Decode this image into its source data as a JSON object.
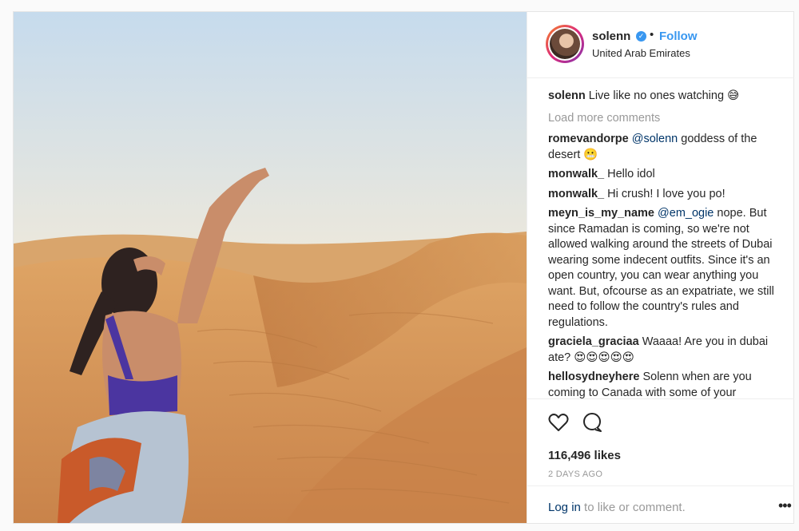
{
  "post": {
    "username": "solenn",
    "follow_label": "Follow",
    "dot": "•",
    "location": "United Arab Emirates",
    "caption_user": "solenn",
    "caption_text": "Live like no ones watching 😅",
    "load_more": "Load more comments",
    "comments": [
      {
        "user": "romevandorpe",
        "mention": "@solenn",
        "text": "goddess of the desert 😬"
      },
      {
        "user": "monwalk_",
        "mention": "",
        "text": "Hello idol"
      },
      {
        "user": "monwalk_",
        "mention": "",
        "text": "Hi crush! I love you po!"
      },
      {
        "user": "meyn_is_my_name",
        "mention": "@em_ogie",
        "text": "nope. But since Ramadan is coming, so we're not allowed walking around the streets of Dubai wearing some indecent outfits. Since it's an open country, you can wear anything you want. But, ofcourse as an expatriate, we still need to follow the country's rules and regulations."
      },
      {
        "user": "graciela_graciaa",
        "mention": "",
        "text": "Waaaa! Are you in dubai ate? 😍😍😍😍😍"
      },
      {
        "user": "hellosydneyhere",
        "mention": "",
        "text": "Solenn when are you coming to Canada with some of your"
      }
    ],
    "likes": "116,496 likes",
    "date": "2 DAYS AGO",
    "login_link": "Log in",
    "login_rest": "to like or comment.",
    "more_label": "•••"
  },
  "icons": {
    "verified": "verified-badge-icon",
    "like": "heart-icon",
    "comment": "speech-bubble-icon",
    "more": "more-options-icon"
  },
  "colors": {
    "link_blue": "#3897f0",
    "mention_blue": "#003569",
    "muted": "#999999",
    "sky_top": "#c9dced",
    "sand": "#d89a5c"
  }
}
